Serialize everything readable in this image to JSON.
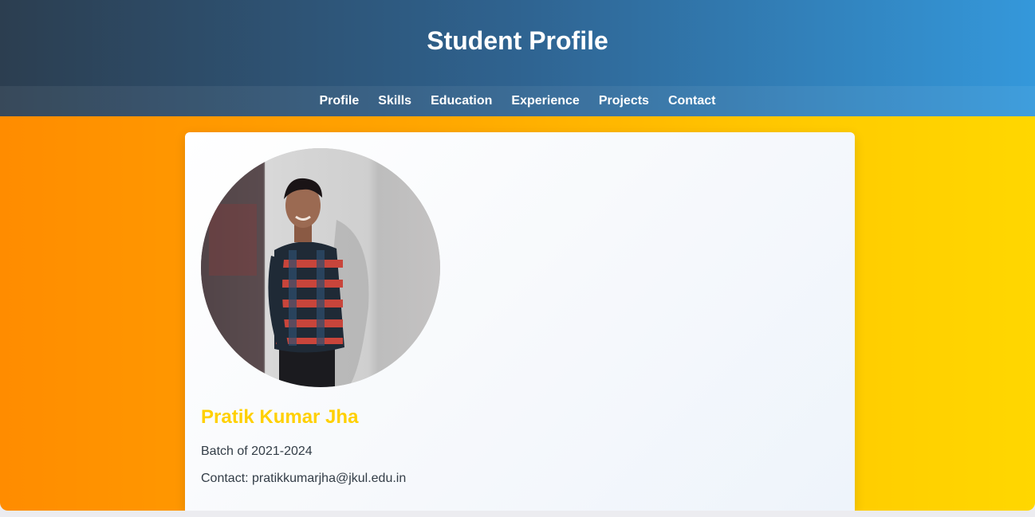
{
  "header": {
    "title": "Student Profile"
  },
  "nav": {
    "items": [
      {
        "label": "Profile"
      },
      {
        "label": "Skills"
      },
      {
        "label": "Education"
      },
      {
        "label": "Experience"
      },
      {
        "label": "Projects"
      },
      {
        "label": "Contact"
      }
    ]
  },
  "profile": {
    "name": "Pratik Kumar Jha",
    "batch": "Batch of 2021-2024",
    "contact": "Contact: pratikkumarjha@jkul.edu.in",
    "photo_icon": "profile-photo"
  },
  "colors": {
    "header_start": "#2c3e50",
    "header_end": "#3498db",
    "main_start": "#ff8c00",
    "main_end": "#ffd700",
    "name_color": "#ffd000",
    "text_color": "#333d47"
  }
}
